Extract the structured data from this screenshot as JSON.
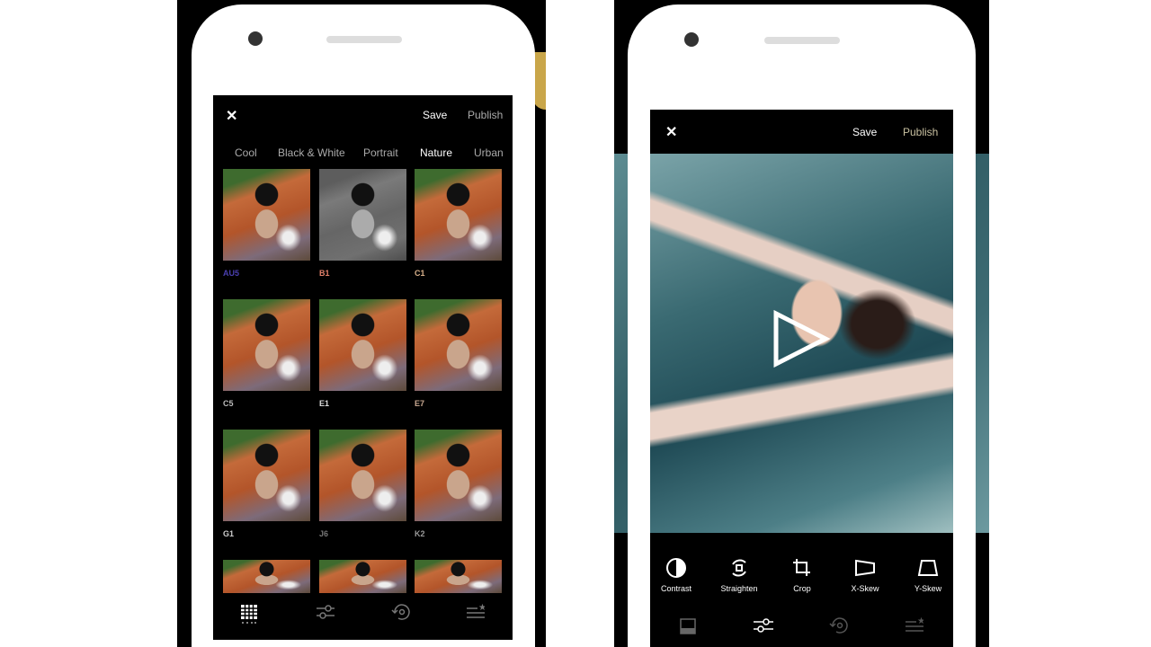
{
  "left": {
    "save": "Save",
    "publish": "Publish",
    "tabs": [
      "Cool",
      "Black & White",
      "Portrait",
      "Nature",
      "Urban"
    ],
    "active_tab": "Nature",
    "presets": [
      {
        "label": "AU5",
        "color": "#4a3fb0"
      },
      {
        "label": "B1",
        "color": "#e0806a"
      },
      {
        "label": "C1",
        "color": "#d8b08a"
      },
      {
        "label": "C5",
        "color": "#bbbbbb"
      },
      {
        "label": "E1",
        "color": "#dddddd"
      },
      {
        "label": "E7",
        "color": "#c8a890"
      },
      {
        "label": "G1",
        "color": "#cccccc"
      },
      {
        "label": "J6",
        "color": "#777777"
      },
      {
        "label": "K2",
        "color": "#999999"
      }
    ],
    "nav": [
      "grid-icon",
      "sliders-icon",
      "history-icon",
      "recipes-icon"
    ],
    "active_nav": "grid-icon"
  },
  "right": {
    "save": "Save",
    "publish": "Publish",
    "tools": [
      "Contrast",
      "Straighten",
      "Crop",
      "X-Skew",
      "Y-Skew"
    ],
    "nav": [
      "image-icon",
      "sliders-icon",
      "history-icon",
      "recipes-icon"
    ],
    "active_nav": "sliders-icon"
  }
}
